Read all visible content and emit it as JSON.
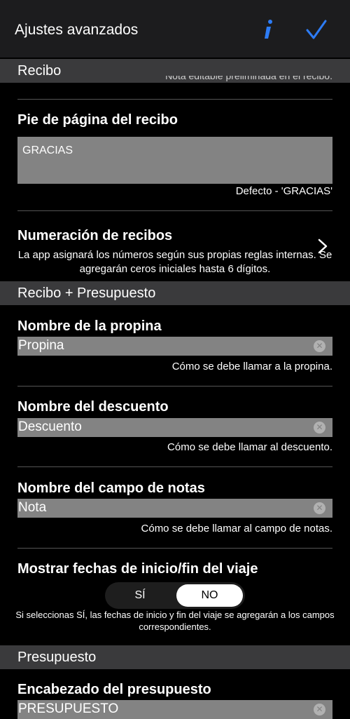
{
  "nav": {
    "title": "Ajustes avanzados"
  },
  "sections": {
    "recibo": "Recibo",
    "recibo_presupuesto": "Recibo + Presupuesto",
    "presupuesto": "Presupuesto"
  },
  "recibo": {
    "cut_hint": "Nota editable preliminada en el recibo.",
    "footer_label": "Pie de página del recibo",
    "footer_value": "GRACIAS",
    "footer_hint": "Defecto - 'GRACIAS'",
    "numbering_label": "Numeración de recibos",
    "numbering_hint": "La app asignará los números según sus propias reglas internas. Se agregarán ceros iniciales hasta 6 dígitos."
  },
  "recibo_presupuesto": {
    "tip_label": "Nombre de la propina",
    "tip_value": "Propina",
    "tip_hint": "Cómo se debe llamar a la propina.",
    "discount_label": "Nombre del descuento",
    "discount_value": "Descuento",
    "discount_hint": "Cómo se debe llamar al descuento.",
    "notes_label": "Nombre del campo de notas",
    "notes_value": "Nota",
    "notes_hint": "Cómo se debe llamar al campo de notas.",
    "dates_label": "Mostrar fechas de inicio/fin del viaje",
    "dates_opt_yes": "SÍ",
    "dates_opt_no": "NO",
    "dates_hint": "Si seleccionas SÍ, las fechas de inicio y fin del viaje se agregarán a los campos correspondientes."
  },
  "presupuesto": {
    "header_label": "Encabezado del presupuesto",
    "header_value": "PRESUPUESTO"
  },
  "colors": {
    "accent": "#2d7cf6",
    "nav_bg": "#1c1c1e",
    "section_bg": "#3a3a3c",
    "input_bg": "#838383"
  }
}
